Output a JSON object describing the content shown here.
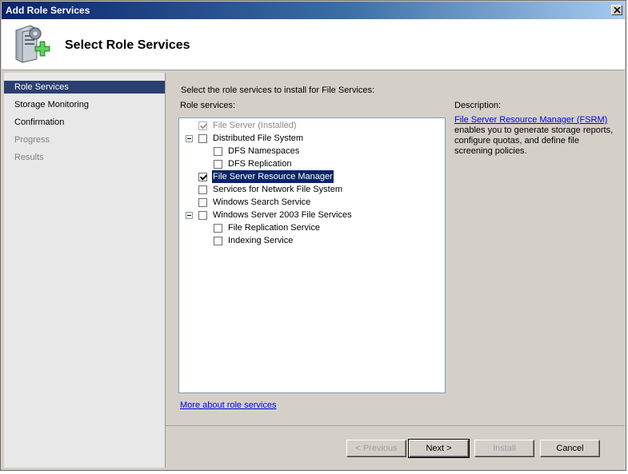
{
  "window": {
    "title": "Add Role Services"
  },
  "header": {
    "title": "Select Role Services"
  },
  "nav": {
    "items": [
      {
        "label": "Role Services",
        "state": "active"
      },
      {
        "label": "Storage Monitoring",
        "state": "normal"
      },
      {
        "label": "Confirmation",
        "state": "normal"
      },
      {
        "label": "Progress",
        "state": "disabled"
      },
      {
        "label": "Results",
        "state": "disabled"
      }
    ]
  },
  "content": {
    "instruction": "Select the role services to install for File Services:",
    "list_label": "Role services:",
    "description_label": "Description:",
    "description_link": "File Server Resource Manager (FSRM)",
    "description_text": "enables you to generate storage reports, configure quotas, and define file screening policies.",
    "more_link": "More about role services",
    "services": [
      {
        "label": "File Server  (Installed)",
        "checked": true,
        "disabled": true,
        "level": 0,
        "expander": false
      },
      {
        "label": "Distributed File System",
        "checked": false,
        "level": 0,
        "expander": true
      },
      {
        "label": "DFS Namespaces",
        "checked": false,
        "level": 1,
        "expander": false
      },
      {
        "label": "DFS Replication",
        "checked": false,
        "level": 1,
        "expander": false
      },
      {
        "label": "File Server Resource Manager",
        "checked": true,
        "selected": true,
        "level": 0,
        "expander": false
      },
      {
        "label": "Services for Network File System",
        "checked": false,
        "level": 0,
        "expander": false
      },
      {
        "label": "Windows Search Service",
        "checked": false,
        "level": 0,
        "expander": false
      },
      {
        "label": "Windows Server 2003 File Services",
        "checked": false,
        "level": 0,
        "expander": true
      },
      {
        "label": "File Replication Service",
        "checked": false,
        "level": 1,
        "expander": false
      },
      {
        "label": "Indexing Service",
        "checked": false,
        "level": 1,
        "expander": false
      }
    ]
  },
  "buttons": {
    "previous": "< Previous",
    "next": "Next >",
    "install": "Install",
    "cancel": "Cancel"
  },
  "icons": {
    "logo": "server-add-role-icon",
    "close": "close-icon"
  },
  "colors": {
    "accent": "#2c3f73",
    "selection": "#0a246a",
    "link": "#0000ee",
    "dialog": "#d4d0c8"
  }
}
